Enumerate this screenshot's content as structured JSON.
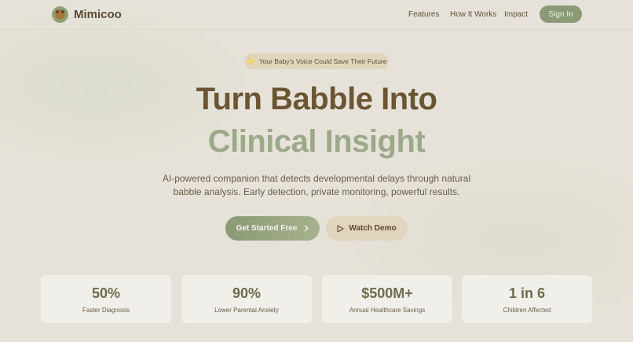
{
  "header": {
    "brand": "Mimicoo",
    "logo_icon": "baby-face-icon",
    "nav": [
      "Features",
      "How It Works",
      "Impact"
    ],
    "signin_label": "Sign In"
  },
  "hero": {
    "badge_icon": "sparkles-icon",
    "badge_text": "Your Baby's Voice Could Save Their Future",
    "title_line1": "Turn Babble Into",
    "title_line2": "Clinical Insight",
    "subtitle": "AI-powered companion that detects developmental delays through natural babble analysis. Early detection, private monitoring, powerful results.",
    "primary_cta": "Get Started Free",
    "primary_cta_icon": "chevron-right-icon",
    "secondary_cta": "Watch Demo",
    "secondary_cta_icon": "play-icon"
  },
  "stats": [
    {
      "value": "50%",
      "label": "Faster Diagnosis"
    },
    {
      "value": "90%",
      "label": "Lower Parental Anxiety"
    },
    {
      "value": "$500M+",
      "label": "Annual Healthcare Savings"
    },
    {
      "value": "1 in 6",
      "label": "Children Affected"
    }
  ],
  "colors": {
    "accent_green": "#8a9a76",
    "title_brown": "#6b5633",
    "title_green": "#9ba989",
    "badge_bg": "#e2d5bd"
  }
}
